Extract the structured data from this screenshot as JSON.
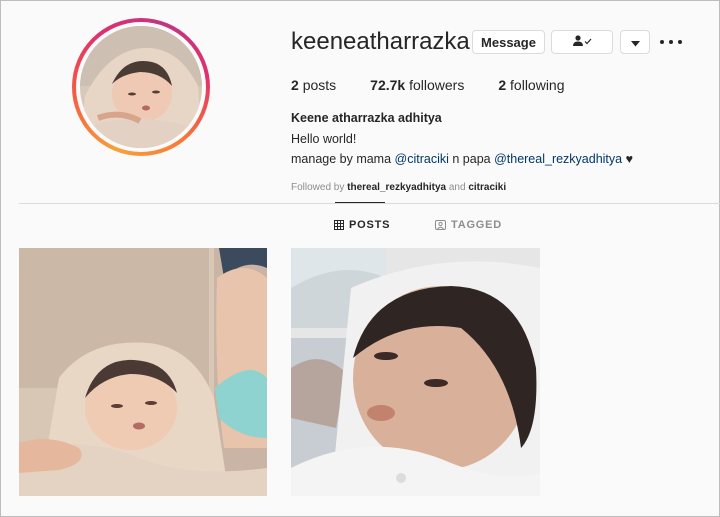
{
  "profile": {
    "username": "keeneatharrazka",
    "message_label": "Message",
    "follow_icon": "person-check-icon",
    "dropdown_icon": "chevron-down-icon",
    "more_icon": "more-options-icon",
    "stats": {
      "posts_count": "2",
      "posts_label": "posts",
      "followers_count": "72.7k",
      "followers_label": "followers",
      "following_count": "2",
      "following_label": "following"
    },
    "full_name": "Keene atharrazka adhitya",
    "bio_line1": "Hello world!",
    "bio_line2_prefix": "manage by mama ",
    "bio_mention1": "@citraciki",
    "bio_line2_mid": " n papa ",
    "bio_mention2": "@thereal_rezkyadhitya",
    "bio_heart": "♥",
    "followed_by_prefix": "Followed by ",
    "followed_by_user1": "thereal_rezkyadhitya",
    "followed_by_and": " and ",
    "followed_by_user2": "citraciki"
  },
  "tabs": {
    "posts": "POSTS",
    "tagged": "TAGGED"
  },
  "colors": {
    "mention": "#00376b",
    "ring_start": "#f9a13a",
    "ring_end": "#c13584"
  }
}
